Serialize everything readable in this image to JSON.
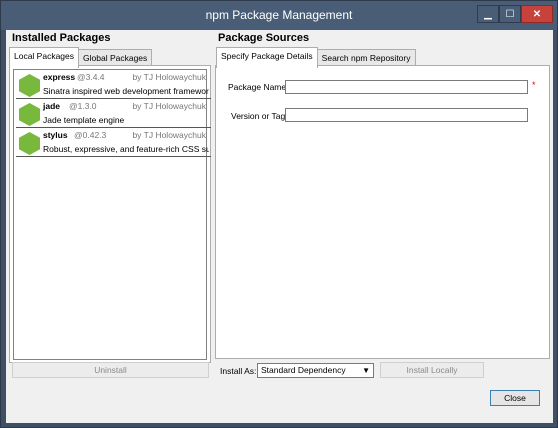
{
  "window": {
    "title": "npm Package Management",
    "minimize": "▁",
    "maximize": "☐",
    "close": "✕"
  },
  "installed": {
    "header": "Installed Packages",
    "tabs": [
      "Local Packages",
      "Global Packages"
    ],
    "packages": [
      {
        "name": "express",
        "version": "@3.4.4",
        "author": "by TJ Holowaychuk",
        "description": "Sinatra inspired web development framework"
      },
      {
        "name": "jade",
        "version": "@1.3.0",
        "author": "by TJ Holowaychuk",
        "description": "Jade template engine"
      },
      {
        "name": "stylus",
        "version": "@0.42.3",
        "author": "by TJ Holowaychuk",
        "description": "Robust, expressive, and feature-rich CSS sup..."
      }
    ],
    "uninstall_label": "Uninstall"
  },
  "sources": {
    "header": "Package Sources",
    "tabs": [
      "Specify Package Details",
      "Search npm Repository"
    ],
    "package_name_label": "Package Name:",
    "package_name_value": "",
    "required_marker": "*",
    "version_label": "Version or Tag:",
    "version_value": "",
    "install_as_label": "Install As:",
    "install_as_value": "Standard Dependency",
    "install_locally_label": "Install Locally"
  },
  "footer": {
    "close_label": "Close"
  },
  "colors": {
    "titlebar": "#4a5d77",
    "close_button": "#c7423a",
    "package_hexagon": "#78b83c"
  }
}
